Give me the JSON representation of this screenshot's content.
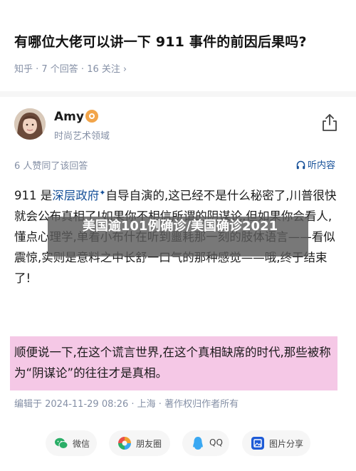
{
  "question": {
    "title": "有哪位大佬可以讲一下 911 事件的前因后果吗?",
    "meta": "知乎 · 7 个回答 · 16 关注",
    "meta_chevron": "›"
  },
  "answer": {
    "author_name": "Amy",
    "author_desc": "时尚艺术领域",
    "stats": "6 人赞同了该回答",
    "listen_label": "听内容",
    "body_prefix": "911 是",
    "link_text": "深层政府",
    "link_plus": "✦",
    "body_rest": "自导自演的,这已经不是什么秘密了,川普很快就会公布真相了!如果你不相信所谓的阴谋论,但如果你会看人,懂点心理学,单看小布什在听到噩耗那一刻的肢体语言——看似震惊,实则是意料之中长舒一口气的那种感觉——哦,终于结束了!",
    "highlight_text": "顺便说一下,在这个谎言世界,在这个真相缺席的时代,那些被称为“阴谋论”的往往才是真相。",
    "edited": "编辑于 2024-11-29 08:26 · 上海 · 著作权归作者所有"
  },
  "overlay": {
    "text": "美国逾101例确诊/美国确诊2021"
  },
  "share": {
    "buttons": [
      {
        "label": "微信",
        "icon": "wechat-icon",
        "color": "#2aae67"
      },
      {
        "label": "朋友圈",
        "icon": "moments-icon",
        "color": "#f0a030"
      },
      {
        "label": "QQ",
        "icon": "qq-icon",
        "color": "#3aa8f2"
      },
      {
        "label": "图片分享",
        "icon": "image-share-icon",
        "color": "#1e5bd6"
      }
    ]
  },
  "colors": {
    "link": "#175199",
    "meta": "#8590a6",
    "highlight": "#f5c8e6"
  }
}
